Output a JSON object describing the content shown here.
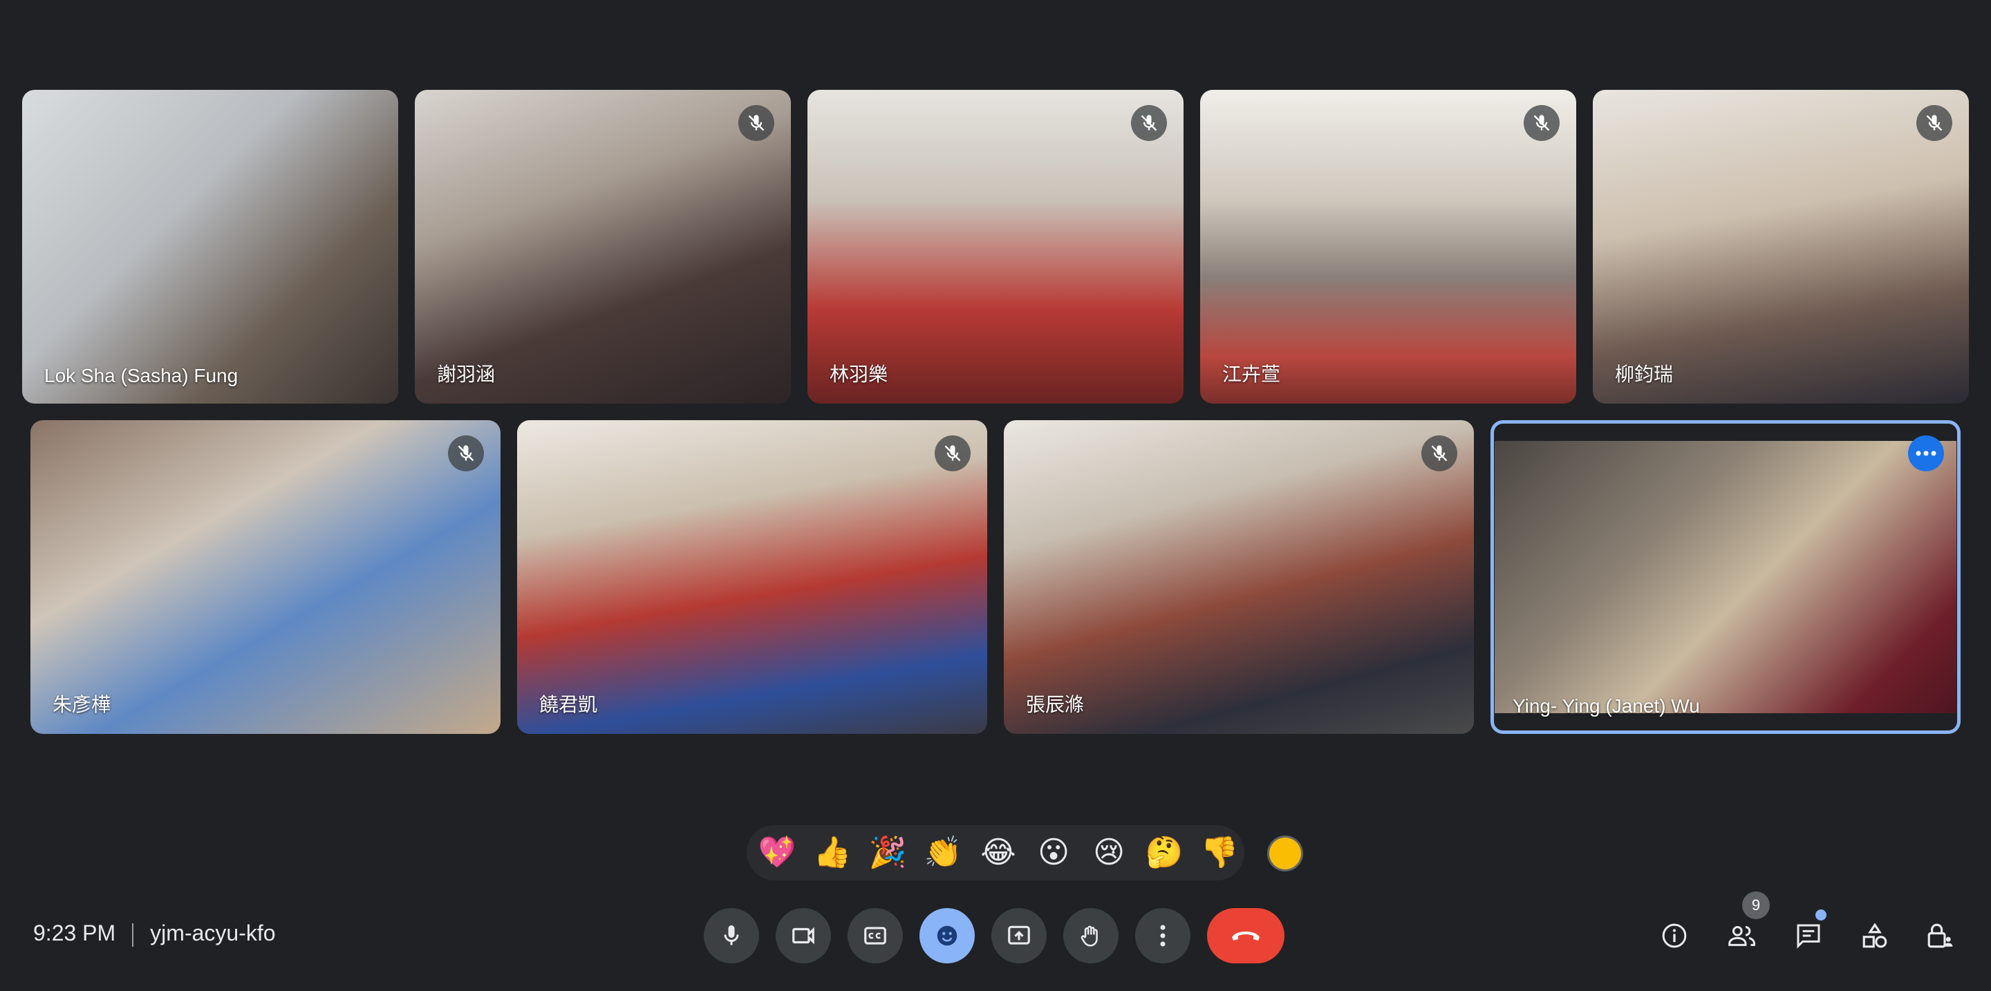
{
  "participants": [
    {
      "name": "Lok Sha (Sasha) Fung",
      "muted": false
    },
    {
      "name": "謝羽涵",
      "muted": true
    },
    {
      "name": "林羽樂",
      "muted": true
    },
    {
      "name": "江卉萱",
      "muted": true
    },
    {
      "name": "柳鈞瑞",
      "muted": true
    },
    {
      "name": "朱彥樺",
      "muted": true
    },
    {
      "name": "饒君凱",
      "muted": true
    },
    {
      "name": "張辰滌",
      "muted": true
    },
    {
      "name": "Ying- Ying (Janet) Wu",
      "muted": false,
      "active": true
    }
  ],
  "reactions": [
    "💖",
    "👍",
    "🎉",
    "👏",
    "😂",
    "😮",
    "😢",
    "🤔",
    "👎"
  ],
  "meeting": {
    "time": "9:23 PM",
    "code": "yjm-acyu-kfo"
  },
  "controls": [
    "microphone",
    "camera",
    "captions",
    "emoji",
    "present",
    "raise-hand",
    "more-options",
    "leave-call"
  ],
  "side_controls": [
    "info",
    "people",
    "chat",
    "activities",
    "host-controls"
  ],
  "people_count": "9",
  "colors": {
    "background": "#202124",
    "accent": "#8ab4f8",
    "danger": "#ea4335",
    "control": "#3c4043"
  }
}
